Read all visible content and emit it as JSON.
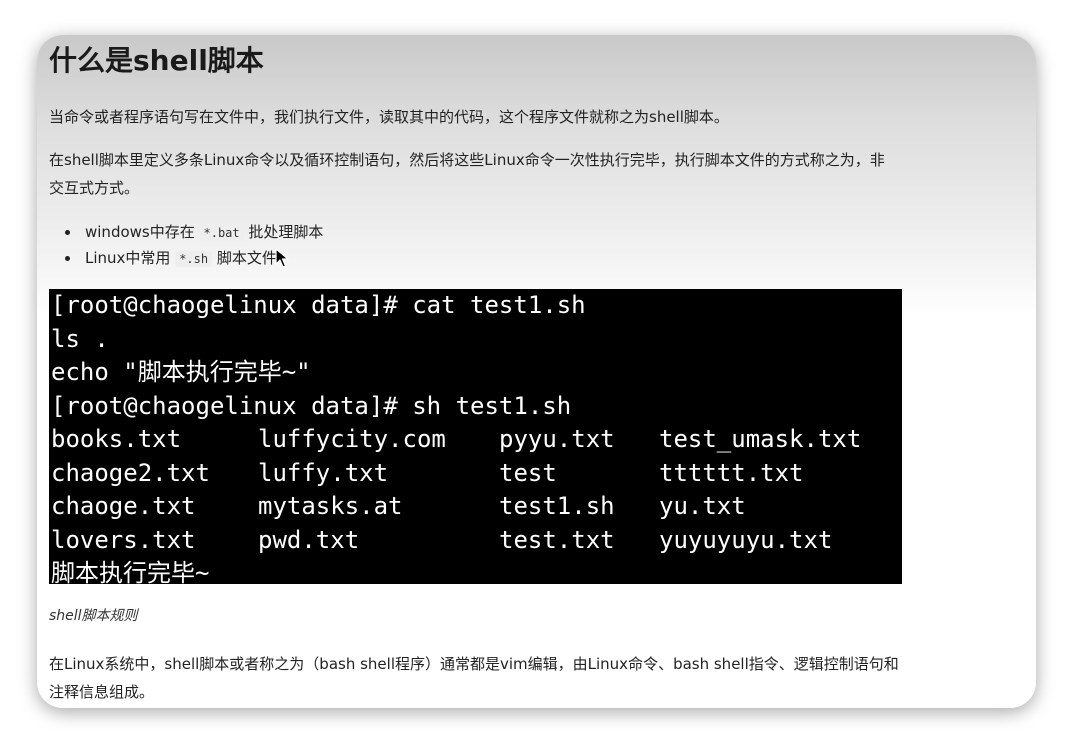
{
  "article": {
    "title": "什么是shell脚本",
    "para1": "当命令或者程序语句写在文件中，我们执行文件，读取其中的代码，这个程序文件就称之为shell脚本。",
    "para2": "在shell脚本里定义多条Linux命令以及循环控制语句，然后将这些Linux命令一次性执行完毕，执行脚本文件的方式称之为，非交互式方式。",
    "bullets": [
      {
        "prefix": "windows中存在 ",
        "code": "*.bat",
        "suffix": " 批处理脚本"
      },
      {
        "prefix": "Linux中常用 ",
        "code": "*.sh",
        "suffix": " 脚本文件"
      }
    ],
    "caption": "shell脚本规则",
    "para3": "在Linux系统中，shell脚本或者称之为（bash shell程序）通常都是vim编辑，由Linux命令、bash shell指令、逻辑控制语句和注释信息组成。"
  },
  "terminal": {
    "lines": [
      "[root@chaogelinux data]# cat test1.sh",
      "ls .",
      "echo \"脚本执行完毕~\"",
      "[root@chaogelinux data]# sh test1.sh"
    ],
    "ls_rows": [
      [
        "books.txt",
        "luffycity.com",
        "pyyu.txt",
        "test_umask.txt"
      ],
      [
        "chaoge2.txt",
        "luffy.txt",
        "test",
        "tttttt.txt"
      ],
      [
        "chaoge.txt",
        "mytasks.at",
        "test1.sh",
        "yu.txt"
      ],
      [
        "lovers.txt",
        "pwd.txt",
        "test.txt",
        "yuyuyuyu.txt"
      ]
    ],
    "final_line": "脚本执行完毕~"
  },
  "colors": {
    "terminal_bg": "#000000",
    "terminal_fg": "#ffffff",
    "text": "#222222"
  },
  "icons": {
    "cursor": "mouse-pointer-icon"
  }
}
